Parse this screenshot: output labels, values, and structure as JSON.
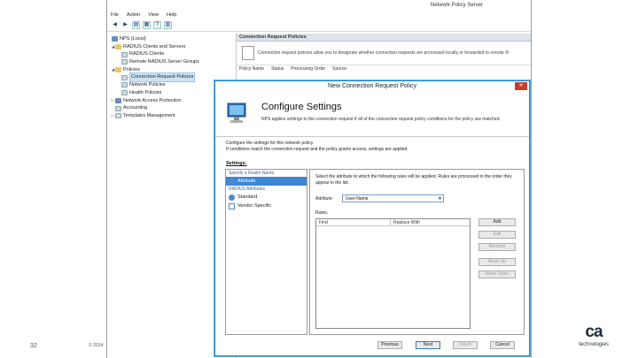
{
  "nps_window": {
    "title": "Network Policy Server",
    "menu": [
      "File",
      "Action",
      "View",
      "Help"
    ],
    "tree": [
      {
        "label": "NPS (Local)",
        "level": 0,
        "twisty": ""
      },
      {
        "label": "RADIUS Clients and Servers",
        "level": 1,
        "twisty": "◢"
      },
      {
        "label": "RADIUS Clients",
        "level": 2,
        "twisty": ""
      },
      {
        "label": "Remote RADIUS Server Groups",
        "level": 2,
        "twisty": ""
      },
      {
        "label": "Policies",
        "level": 1,
        "twisty": "◢"
      },
      {
        "label": "Connection Request Policies",
        "level": 2,
        "twisty": ""
      },
      {
        "label": "Network Policies",
        "level": 2,
        "twisty": ""
      },
      {
        "label": "Health Policies",
        "level": 2,
        "twisty": ""
      },
      {
        "label": "Network Access Protection",
        "level": 1,
        "twisty": "▷"
      },
      {
        "label": "Accounting",
        "level": 1,
        "twisty": ""
      },
      {
        "label": "Templates Management",
        "level": 1,
        "twisty": "▷"
      }
    ],
    "pane_header": "Connection Request Policies",
    "pane_description": "Connection request policies allow you to designate whether connection requests are processed locally or forwarded to remote R",
    "pane_columns": [
      "Policy Name",
      "Status",
      "Processing Order",
      "Source"
    ]
  },
  "dialog": {
    "title": "New Connection Request Policy",
    "close_glyph": "✕",
    "heading": "Configure Settings",
    "subtitle": "NPS applies settings to the connection request if all of the connection request policy conditions for the policy are matched.",
    "info_line1": "Configure the settings for this network policy.",
    "info_line2": "If conditions match the connection request and the policy grants access, settings are applied.",
    "settings_label": "Settings:",
    "nav": {
      "category1": "Specify a Realm Name",
      "item_attribute": "Attribute",
      "category2": "RADIUS Attributes",
      "item_standard": "Standard",
      "item_vendor": "Vendor Specific"
    },
    "panel": {
      "description": "Select the attribute to which the following rules will be applied. Rules are processed in the order they appear in the list.",
      "attribute_label": "Attribute:",
      "attribute_value": "User-Name",
      "rules_label": "Rules:",
      "col_find": "Find",
      "col_replace": "Replace With",
      "btn_add": "Add",
      "btn_edit": "Edit",
      "btn_remove": "Remove",
      "btn_move_up": "Move Up",
      "btn_move_down": "Move Down"
    },
    "footer": {
      "previous": "Previous",
      "next": "Next",
      "finish": "Finish",
      "cancel": "Cancel"
    }
  },
  "slide": {
    "number": "32",
    "copyright": "© 2014",
    "logo_text": "ca",
    "logo_sub": "technologies"
  }
}
